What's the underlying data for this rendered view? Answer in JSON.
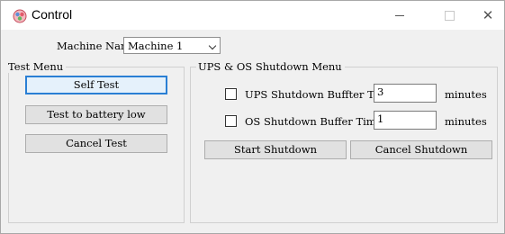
{
  "window": {
    "title": "Control"
  },
  "machine": {
    "label": "Machine Name:",
    "selected": "Machine 1"
  },
  "test_menu": {
    "title": "Test Menu",
    "self_test": "Self Test",
    "test_battery_low": "Test to battery low",
    "cancel_test": "Cancel Test"
  },
  "shutdown_menu": {
    "title": "UPS & OS Shutdown Menu",
    "ups_label": "UPS Shutdown Buffter Time",
    "ups_value": "3",
    "os_label": "OS Shutdown Buffer Time",
    "os_value": "1",
    "unit": "minutes",
    "start": "Start Shutdown",
    "cancel": "Cancel Shutdown"
  },
  "icons": [
    "app-icon",
    "minimize-icon",
    "maximize-icon",
    "close-icon",
    "chevron-down-icon"
  ]
}
